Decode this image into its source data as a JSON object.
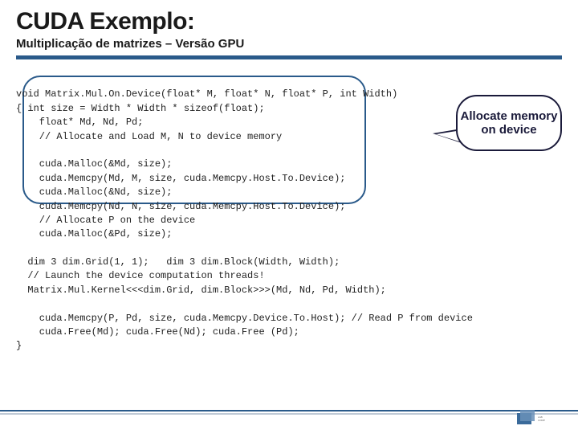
{
  "header": {
    "title": "CUDA Exemplo:",
    "subtitle": "Multiplicação de matrizes – Versão GPU"
  },
  "callout": {
    "text": "Allocate memory on device"
  },
  "code": {
    "l1": "void Matrix.Mul.On.Device(float* M, float* N, float* P, int Width)",
    "l2": "{ int size = Width * Width * sizeof(float);",
    "l3": "    float* Md, Nd, Pd;",
    "l4": "    // Allocate and Load M, N to device memory",
    "l5": "    cuda.Malloc(&Md, size);",
    "l6": "    cuda.Memcpy(Md, M, size, cuda.Memcpy.Host.To.Device);",
    "l7": "    cuda.Malloc(&Nd, size);",
    "l8": "    cuda.Memcpy(Nd, N, size, cuda.Memcpy.Host.To.Device);",
    "l9": "    // Allocate P on the device",
    "l10": "    cuda.Malloc(&Pd, size);",
    "l11": "  dim 3 dim.Grid(1, 1);   dim 3 dim.Block(Width, Width);",
    "l12": "  // Launch the device computation threads!",
    "l13": "  Matrix.Mul.Kernel<<<dim.Grid, dim.Block>>>(Md, Nd, Pd, Width);",
    "l14": "    cuda.Memcpy(P, Pd, size, cuda.Memcpy.Device.To.Host); // Read P from device",
    "l15": "    cuda.Free(Md); cuda.Free(Nd); cuda.Free (Pd);",
    "l16": "}"
  }
}
